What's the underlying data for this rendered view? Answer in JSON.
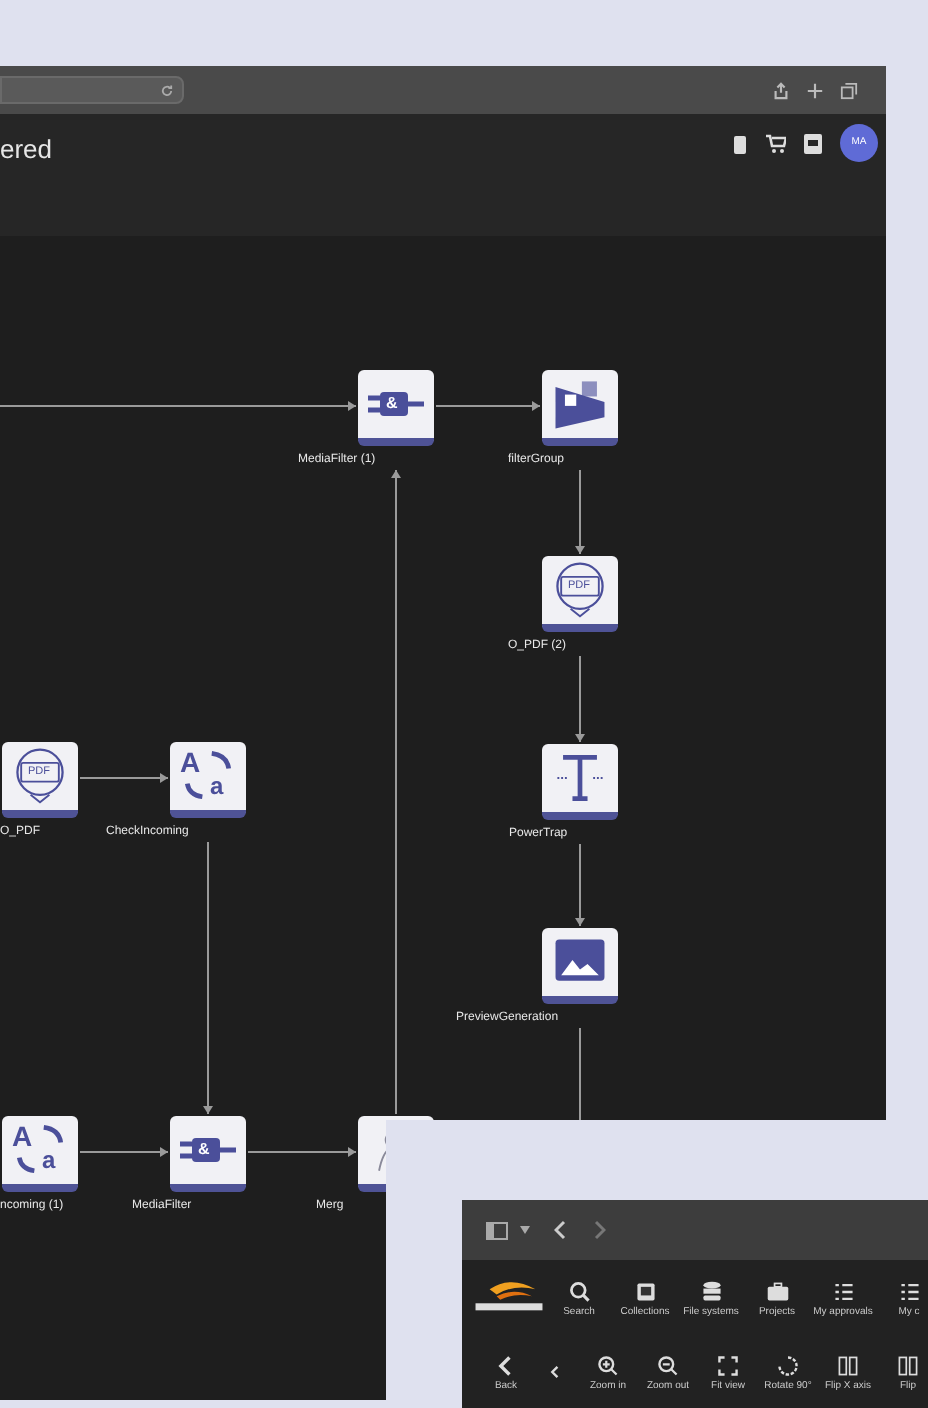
{
  "app_header": {
    "title": "ered",
    "avatar": "MA"
  },
  "nodes": [
    {
      "label": "MediaFilter (1)",
      "kind": "filter",
      "icon_letters": [
        "&"
      ]
    },
    {
      "label": "filterGroup",
      "kind": "group"
    },
    {
      "label": "O_PDF (2)",
      "kind": "pdf",
      "icon_letters": [
        "PDF"
      ]
    },
    {
      "label": "PowerTrap",
      "kind": "text"
    },
    {
      "label": "PreviewGeneration",
      "kind": "image"
    },
    {
      "label": "O_PDF",
      "kind": "pdf",
      "icon_letters": [
        "PDF"
      ]
    },
    {
      "label": "CheckIncoming",
      "kind": "convert",
      "icon_letters": [
        "A",
        "a"
      ]
    },
    {
      "label": "ncoming (1)",
      "kind": "convert",
      "icon_letters": [
        "A",
        "a"
      ]
    },
    {
      "label": "MediaFilter",
      "kind": "filter",
      "icon_letters": [
        "&"
      ]
    },
    {
      "label": "Merg",
      "kind": "merge"
    }
  ],
  "viewer_window": {
    "nav_items": [
      {
        "label": "Search"
      },
      {
        "label": "Collections"
      },
      {
        "label": "File systems"
      },
      {
        "label": "Projects"
      },
      {
        "label": "My approvals"
      },
      {
        "label": "My c"
      }
    ],
    "tool_items": [
      {
        "kind": "labeled",
        "label": "Back"
      },
      {
        "kind": "icon_only"
      },
      {
        "kind": "labeled",
        "label": "Zoom in"
      },
      {
        "kind": "labeled",
        "label": "Zoom out"
      },
      {
        "kind": "labeled",
        "label": "Fit view"
      },
      {
        "kind": "labeled",
        "label": "Rotate 90°"
      },
      {
        "kind": "labeled",
        "label": "Flip X axis"
      },
      {
        "kind": "labeled",
        "label": "Flip"
      }
    ]
  }
}
